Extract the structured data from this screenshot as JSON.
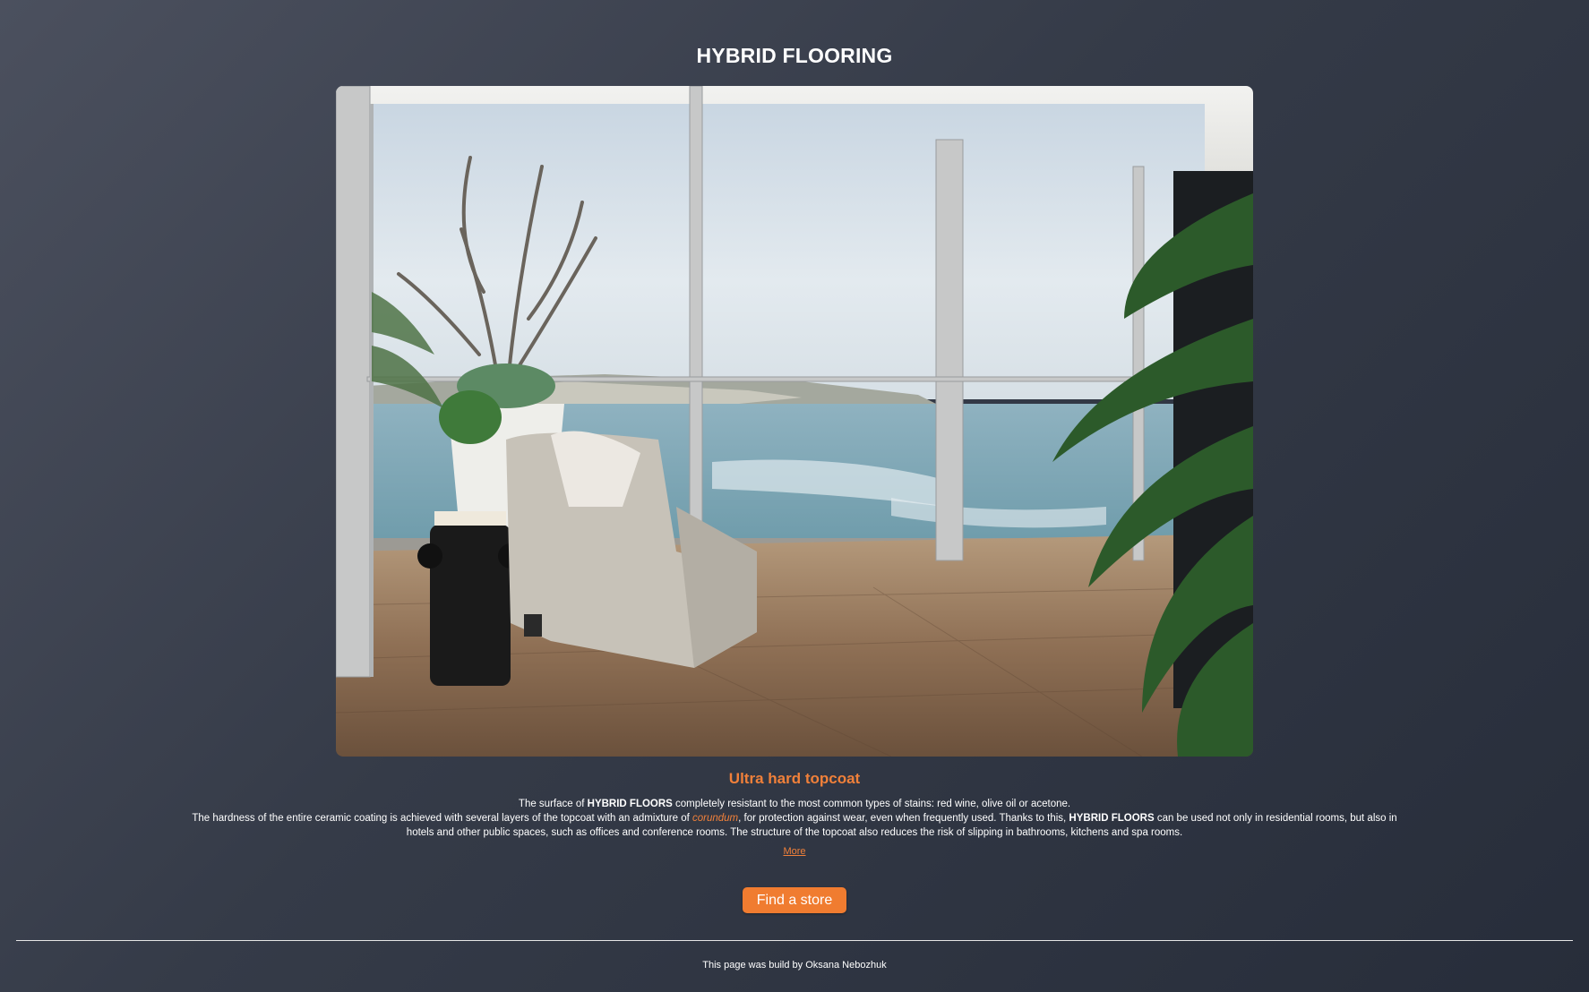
{
  "header": {
    "title": "HYBRID FLOORING"
  },
  "hero": {
    "alt": "Living room with hybrid wood flooring, armchair and sea view"
  },
  "section": {
    "title": "Ultra hard topcoat",
    "line1_a": "The surface of ",
    "brand": "HYBRID FLOORS",
    "line1_b": " completely resistant to the most common types of stains: red wine, olive oil or acetone.",
    "line2_a": "The hardness of the entire ceramic coating is achieved with several layers of the topcoat with an admixture of ",
    "corundum": "corundum",
    "line2_b": ", for protection against wear, even when frequently used. Thanks to this, ",
    "line2_c": " can be used not only in residential rooms, but also in hotels and other public spaces, such as offices and conference rooms. The structure of the topcoat also reduces the risk of slipping in bathrooms, kitchens and spa rooms.",
    "more_label": "More"
  },
  "cta": {
    "find_store_label": "Find a store"
  },
  "footer": {
    "text": "This page was build by Oksana Nebozhuk"
  },
  "colors": {
    "accent": "#f0803a",
    "background": "#353b48",
    "text": "#ffffff"
  }
}
